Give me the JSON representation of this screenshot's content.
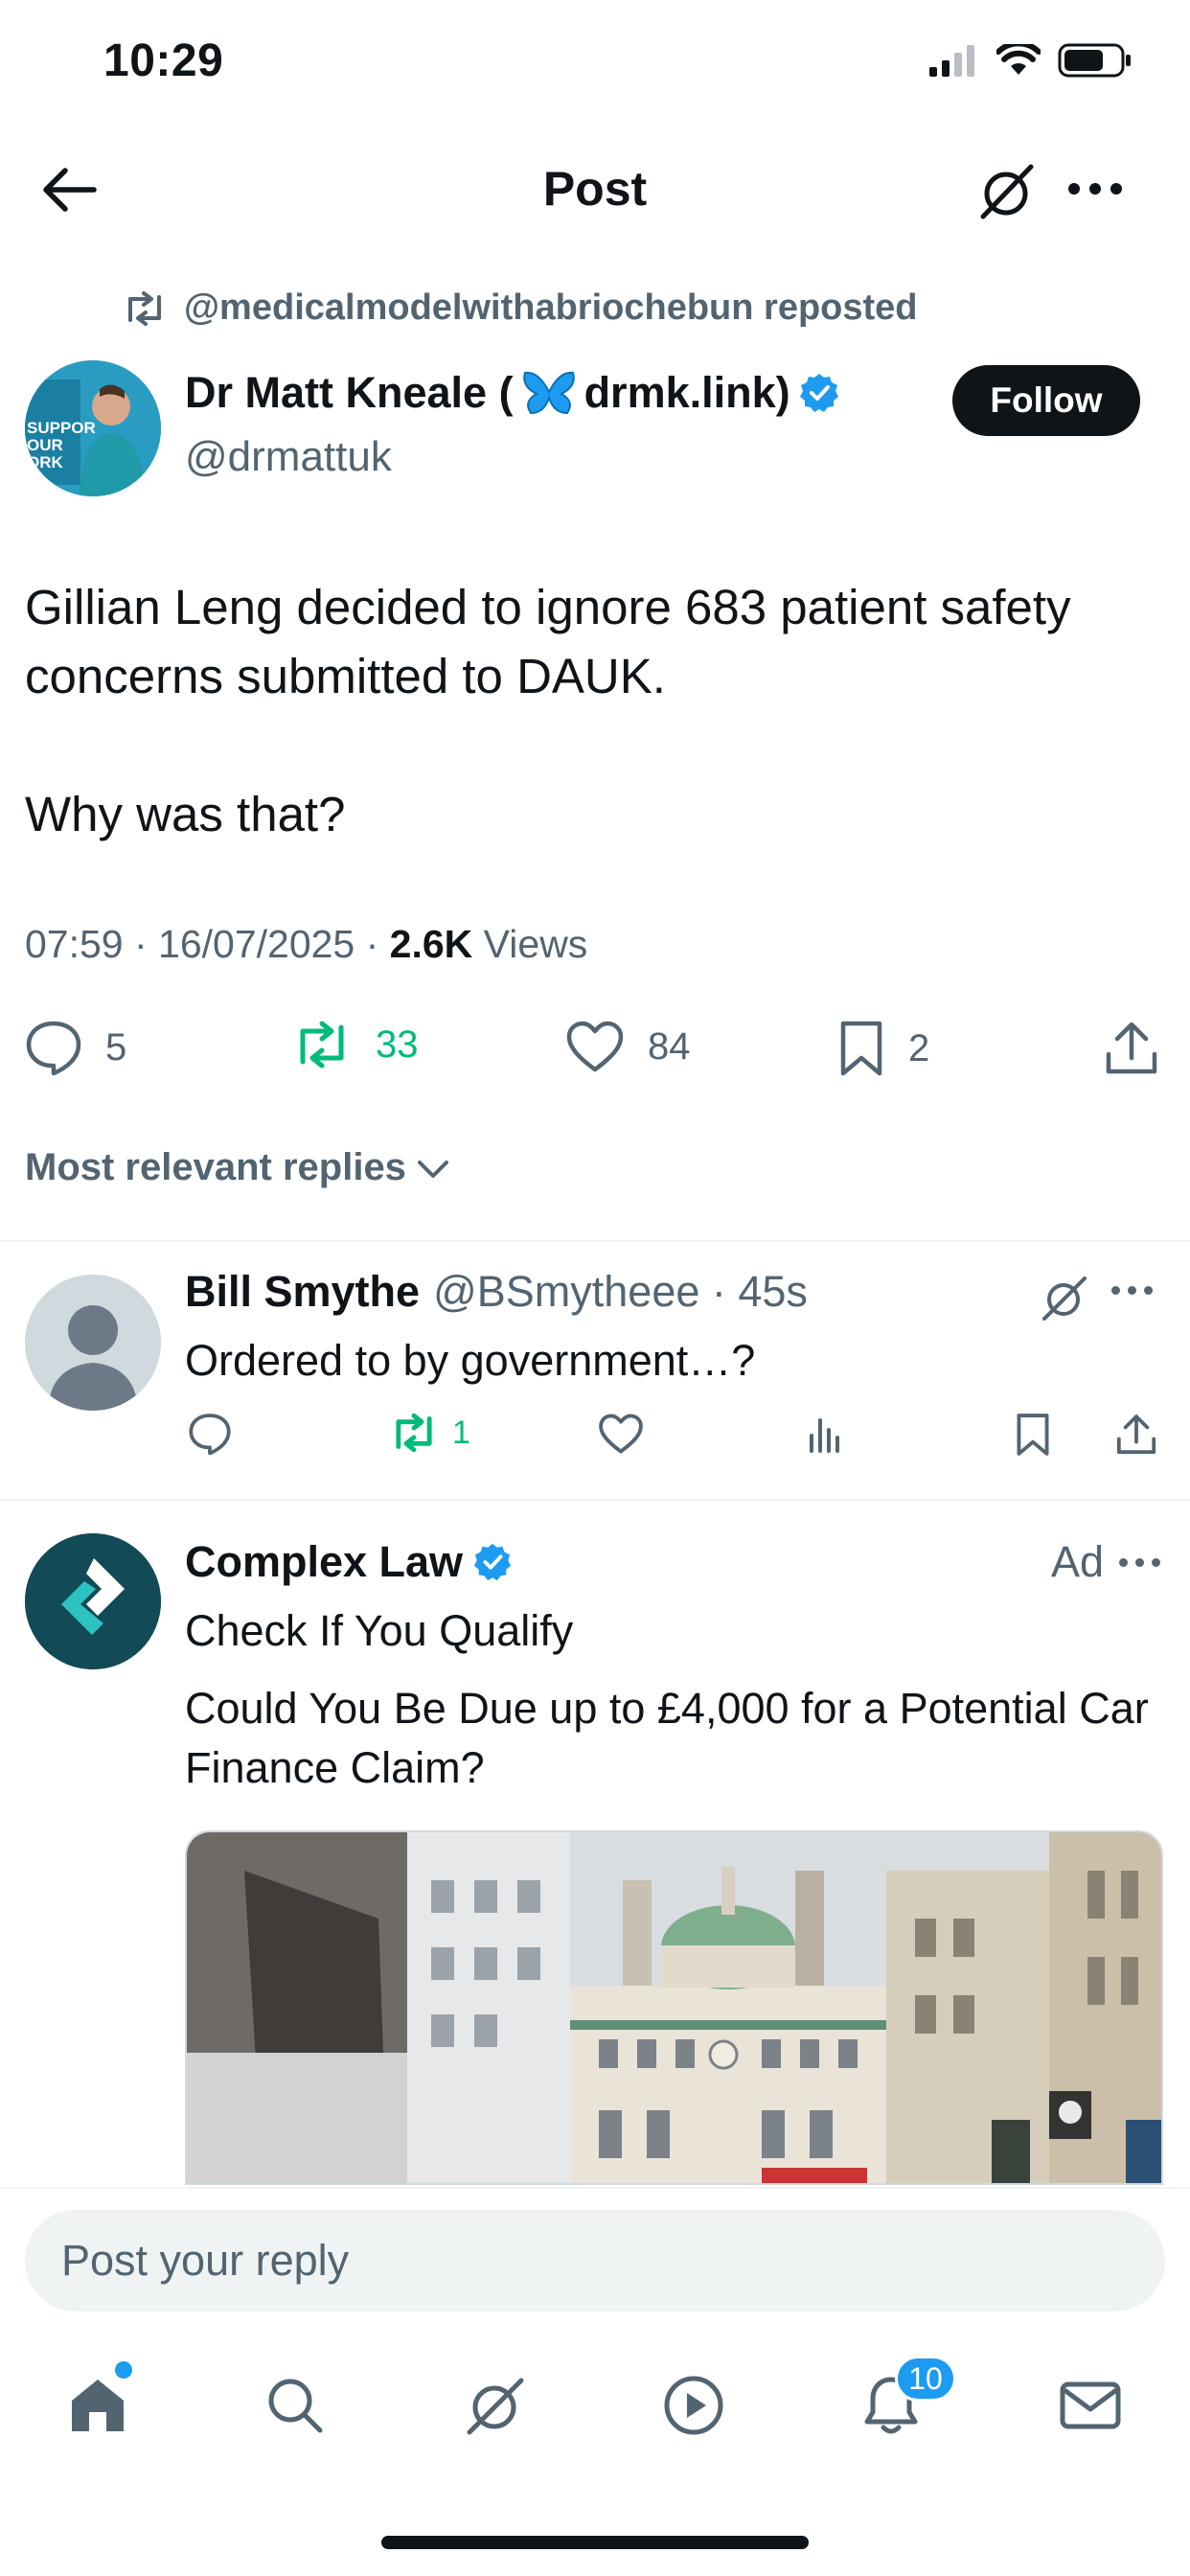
{
  "status_bar": {
    "time": "10:29"
  },
  "header": {
    "title": "Post"
  },
  "repost": {
    "text": "@medicalmodelwithabriochebun reposted"
  },
  "post": {
    "author_name_part1": "Dr Matt Kneale (",
    "author_name_part2": "drmk.link)",
    "author_handle": "@drmattuk",
    "follow_label": "Follow",
    "avatar_sign_text": "SUPPOR\nOUR\nORK",
    "body": "Gillian Leng decided to ignore 683 patient safety concerns submitted to DAUK.\n\nWhy was that?",
    "timestamp": "07:59 · 16/07/2025 · ",
    "views_count": "2.6K",
    "views_label": " Views",
    "replies": "5",
    "reposts": "33",
    "likes": "84",
    "bookmarks": "2"
  },
  "sort": {
    "label": "Most relevant replies"
  },
  "reply": {
    "name": "Bill Smythe",
    "handle_time": "@BSmytheee · 45s",
    "text": "Ordered to by government…?",
    "reposts": "1"
  },
  "ad": {
    "name": "Complex Law",
    "label": "Ad",
    "line1": "Check If You Qualify",
    "line2": "Could You Be Due up to £4,000 for a Potential Car Finance Claim?"
  },
  "composer": {
    "placeholder": "Post your reply"
  },
  "tabbar": {
    "notifications_badge": "10"
  },
  "colors": {
    "accent": "#1d9bf0",
    "repost_green": "#00ba7c",
    "secondary_text": "#536471"
  }
}
